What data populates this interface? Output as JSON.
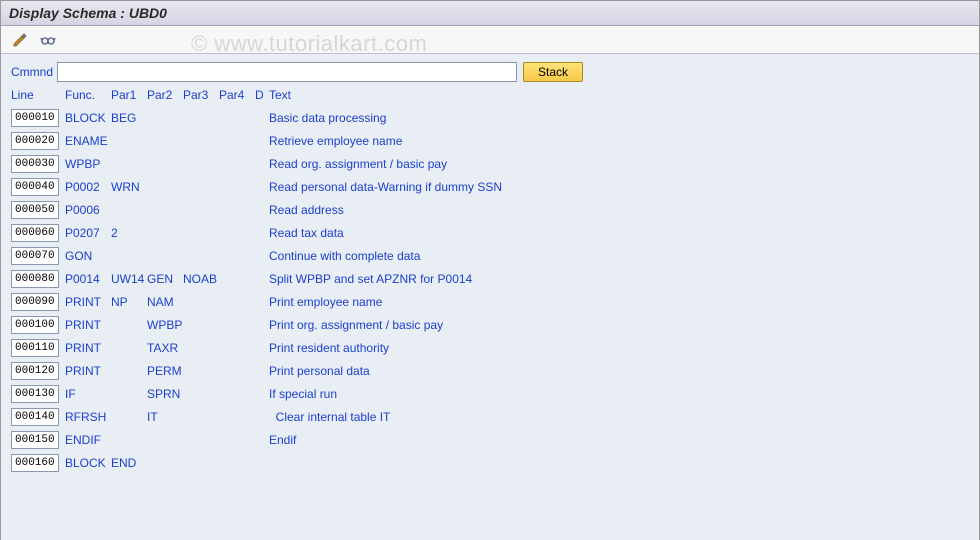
{
  "title": "Display Schema : UBD0",
  "watermark": "© www.tutorialkart.com",
  "toolbar": {
    "icons": [
      "edit-icon",
      "glasses-icon"
    ]
  },
  "command": {
    "label": "Cmmnd",
    "value": "",
    "stack_label": "Stack"
  },
  "headers": {
    "line": "Line",
    "func": "Func.",
    "par1": "Par1",
    "par2": "Par2",
    "par3": "Par3",
    "par4": "Par4",
    "d": "D",
    "text": "Text"
  },
  "rows": [
    {
      "line": "000010",
      "func": "BLOCK",
      "par1": "BEG",
      "par2": "",
      "par3": "",
      "par4": "",
      "d": "",
      "text": "Basic data processing"
    },
    {
      "line": "000020",
      "func": "ENAME",
      "par1": "",
      "par2": "",
      "par3": "",
      "par4": "",
      "d": "",
      "text": "Retrieve employee name"
    },
    {
      "line": "000030",
      "func": "WPBP",
      "par1": "",
      "par2": "",
      "par3": "",
      "par4": "",
      "d": "",
      "text": "Read org. assignment / basic pay"
    },
    {
      "line": "000040",
      "func": "P0002",
      "par1": "WRN",
      "par2": "",
      "par3": "",
      "par4": "",
      "d": "",
      "text": "Read personal data-Warning if dummy SSN"
    },
    {
      "line": "000050",
      "func": "P0006",
      "par1": "",
      "par2": "",
      "par3": "",
      "par4": "",
      "d": "",
      "text": "Read address"
    },
    {
      "line": "000060",
      "func": "P0207",
      "par1": "2",
      "par2": "",
      "par3": "",
      "par4": "",
      "d": "",
      "text": "Read tax data"
    },
    {
      "line": "000070",
      "func": "GON",
      "par1": "",
      "par2": "",
      "par3": "",
      "par4": "",
      "d": "",
      "text": "Continue with complete data"
    },
    {
      "line": "000080",
      "func": "P0014",
      "par1": "UW14",
      "par2": "GEN",
      "par3": "NOAB",
      "par4": "",
      "d": "",
      "text": "Split WPBP and set APZNR for P0014"
    },
    {
      "line": "000090",
      "func": "PRINT",
      "par1": "NP",
      "par2": "NAM",
      "par3": "",
      "par4": "",
      "d": "",
      "text": "Print employee name"
    },
    {
      "line": "000100",
      "func": "PRINT",
      "par1": "",
      "par2": "WPBP",
      "par3": "",
      "par4": "",
      "d": "",
      "text": "Print org. assignment / basic pay"
    },
    {
      "line": "000110",
      "func": "PRINT",
      "par1": "",
      "par2": "TAXR",
      "par3": "",
      "par4": "",
      "d": "",
      "text": "Print resident authority"
    },
    {
      "line": "000120",
      "func": "PRINT",
      "par1": "",
      "par2": "PERM",
      "par3": "",
      "par4": "",
      "d": "",
      "text": "Print personal data"
    },
    {
      "line": "000130",
      "func": "IF",
      "par1": "",
      "par2": "SPRN",
      "par3": "",
      "par4": "",
      "d": "",
      "text": "If special run"
    },
    {
      "line": "000140",
      "func": "RFRSH",
      "par1": "",
      "par2": "IT",
      "par3": "",
      "par4": "",
      "d": "",
      "text": "  Clear internal table IT"
    },
    {
      "line": "000150",
      "func": "ENDIF",
      "par1": "",
      "par2": "",
      "par3": "",
      "par4": "",
      "d": "",
      "text": "Endif"
    },
    {
      "line": "000160",
      "func": "BLOCK",
      "par1": "END",
      "par2": "",
      "par3": "",
      "par4": "",
      "d": "",
      "text": ""
    }
  ]
}
